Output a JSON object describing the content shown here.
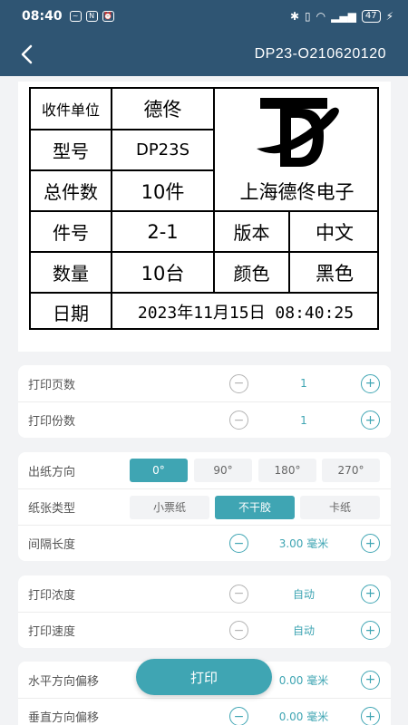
{
  "status_bar": {
    "time": "08:40",
    "battery": "47"
  },
  "app_bar": {
    "title": "DP23-O210620120"
  },
  "label": {
    "cells": {
      "recv_label": "收件单位",
      "recv_value": "德佟",
      "model_label": "型号",
      "model_value": "DP23S",
      "total_label": "总件数",
      "total_value": "10件",
      "piece_label": "件号",
      "piece_value": "2-1",
      "version_label": "版本",
      "version_value": "中文",
      "qty_label": "数量",
      "qty_value": "10台",
      "color_label": "颜色",
      "color_value": "黑色",
      "date_label": "日期",
      "date_value": "2023年11月15日 08:40:25"
    },
    "company": "上海德佟电子"
  },
  "settings": {
    "pages": {
      "label": "打印页数",
      "value": "1"
    },
    "copies": {
      "label": "打印份数",
      "value": "1"
    },
    "direction": {
      "label": "出纸方向",
      "options": [
        "0°",
        "90°",
        "180°",
        "270°"
      ],
      "selected": "0°"
    },
    "paper": {
      "label": "纸张类型",
      "options": [
        "小票纸",
        "不干胶",
        "卡纸"
      ],
      "selected": "不干胶"
    },
    "gap": {
      "label": "间隔长度",
      "value": "3.00 毫米"
    },
    "density": {
      "label": "打印浓度",
      "value": "自动"
    },
    "speed": {
      "label": "打印速度",
      "value": "自动"
    },
    "h_offset": {
      "label": "水平方向偏移",
      "value": "0.00 毫米"
    },
    "v_offset": {
      "label": "垂直方向偏移",
      "value": "0.00 毫米"
    }
  },
  "print_button": "打印",
  "colors": {
    "primary": "#2f5573",
    "accent": "#3fa5b3",
    "background": "#f2f3f5"
  }
}
